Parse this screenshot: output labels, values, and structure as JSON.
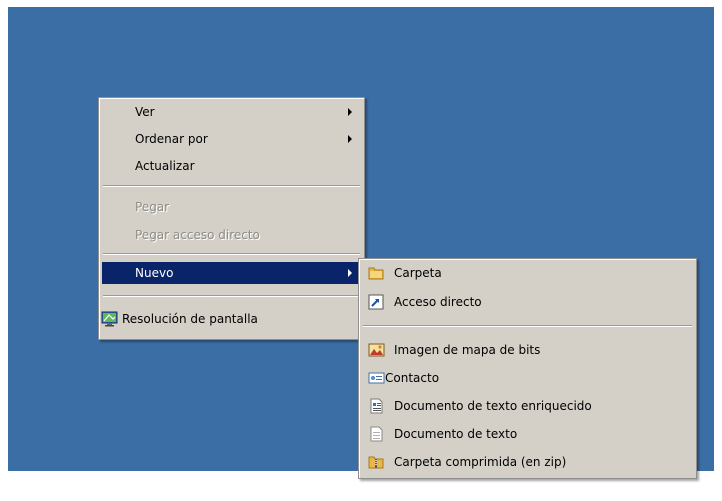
{
  "context_menu": {
    "items": [
      {
        "label": "Ver",
        "has_submenu": true
      },
      {
        "label": "Ordenar por",
        "has_submenu": true
      },
      {
        "label": "Actualizar"
      },
      {
        "label": "Pegar",
        "disabled": true
      },
      {
        "label": "Pegar acceso directo",
        "disabled": true
      },
      {
        "label": "Nuevo",
        "has_submenu": true,
        "highlighted": true
      },
      {
        "label": "Resolución de pantalla",
        "icon": "display-settings-icon"
      }
    ]
  },
  "submenu_nuevo": {
    "items": [
      {
        "label": "Carpeta",
        "icon": "folder-icon"
      },
      {
        "label": "Acceso directo",
        "icon": "shortcut-icon"
      },
      {
        "label": "Imagen de mapa de bits",
        "icon": "bitmap-image-icon"
      },
      {
        "label": "Contacto",
        "icon": "contact-icon"
      },
      {
        "label": "Documento de texto enriquecido",
        "icon": "rich-text-document-icon"
      },
      {
        "label": "Documento de texto",
        "icon": "text-document-icon"
      },
      {
        "label": "Carpeta comprimida (en zip)",
        "icon": "zip-folder-icon"
      }
    ]
  },
  "colors": {
    "desktop": "#3a6ea5",
    "menu_background": "#d4d0c8",
    "highlight": "#0a246a"
  }
}
